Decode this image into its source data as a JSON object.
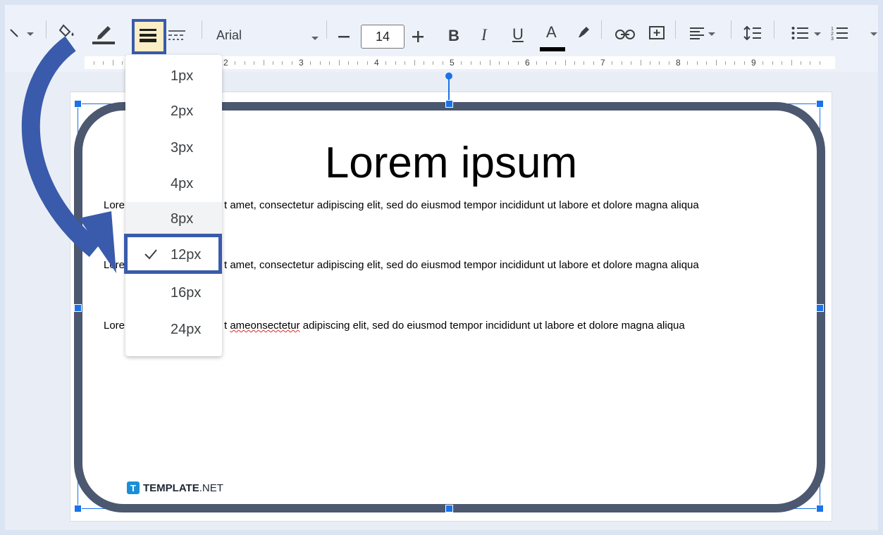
{
  "toolbar": {
    "font_name": "Arial",
    "font_size": "14",
    "bold_label": "B",
    "italic_label": "I",
    "underline_label": "U",
    "text_color_label": "A"
  },
  "ruler": {
    "numbers": [
      "2",
      "3",
      "4",
      "5",
      "6",
      "7",
      "8",
      "9"
    ]
  },
  "dropdown": {
    "items": [
      "1px",
      "2px",
      "3px",
      "4px",
      "8px",
      "12px",
      "16px",
      "24px"
    ],
    "selected": "12px"
  },
  "content": {
    "title": "Lorem ipsum",
    "line1_prefix": "Lore",
    "line1_rest": "t amet, consectetur adipiscing elit, sed do eiusmod tempor incididunt ut labore et dolore magna aliqua",
    "line2_prefix": "Lore",
    "line2_rest": "t amet, consectetur adipiscing elit, sed do eiusmod tempor incididunt ut labore et dolore magna aliqua",
    "line3_prefix": "Lore",
    "line3_squiggle": "ameonsectetur",
    "line3_rest": " adipiscing elit, sed do eiusmod tempor incididunt ut labore et dolore magna aliqua",
    "line3_lead": "t "
  },
  "watermark": {
    "bold": "TEMPLATE",
    "rest": ".NET",
    "mark": "T"
  },
  "colors": {
    "accent": "#3a5bab",
    "selection": "#1a73e8",
    "shape_border": "#4c5870"
  }
}
